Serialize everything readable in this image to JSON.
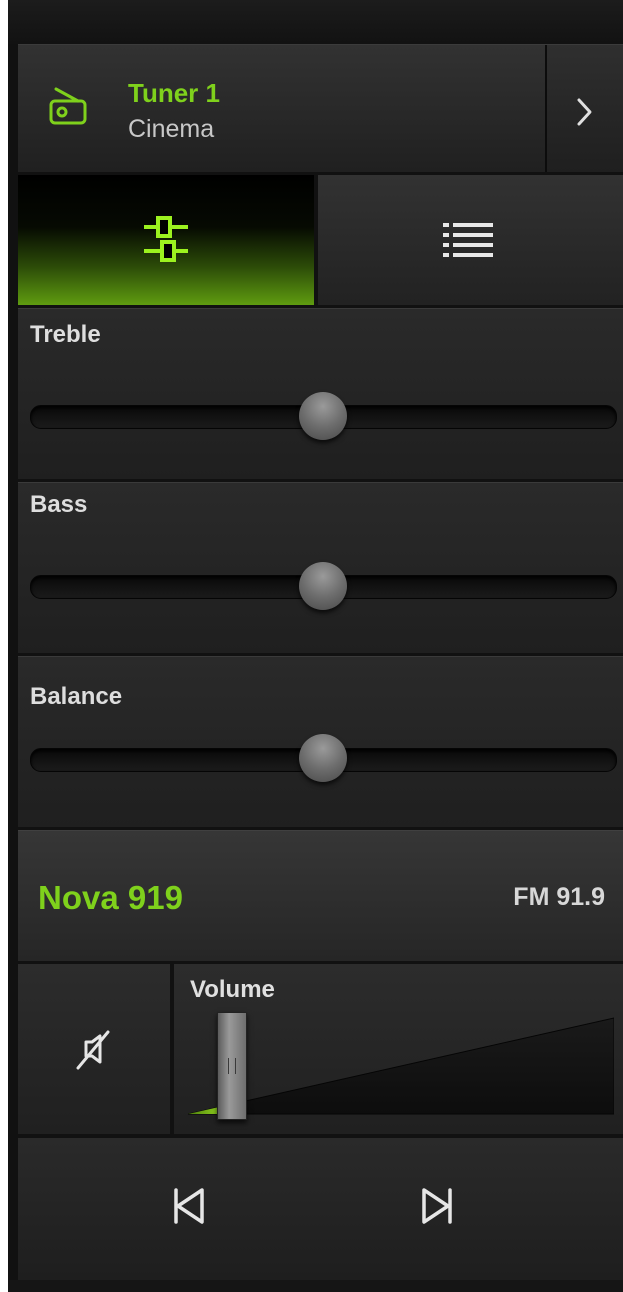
{
  "colors": {
    "accent": "#7fd11c",
    "background": "#1e1e1e",
    "text": "#dedede"
  },
  "source": {
    "icon": "radio-icon",
    "name": "Tuner 1",
    "mode": "Cinema",
    "expand_icon": "chevron-right-icon"
  },
  "tabs": [
    {
      "icon": "equalizer-icon",
      "active": true
    },
    {
      "icon": "list-icon",
      "active": false
    }
  ],
  "sliders": [
    {
      "label": "Treble",
      "value_fraction": 0.5
    },
    {
      "label": "Bass",
      "value_fraction": 0.5
    },
    {
      "label": "Balance",
      "value_fraction": 0.5
    }
  ],
  "station": {
    "name": "Nova 919",
    "frequency": "FM 91.9"
  },
  "volume": {
    "label": "Volume",
    "level_fraction": 0.1,
    "mute_icon": "speaker-muted-icon"
  },
  "transport": {
    "prev_icon": "skip-previous-icon",
    "next_icon": "skip-next-icon"
  }
}
